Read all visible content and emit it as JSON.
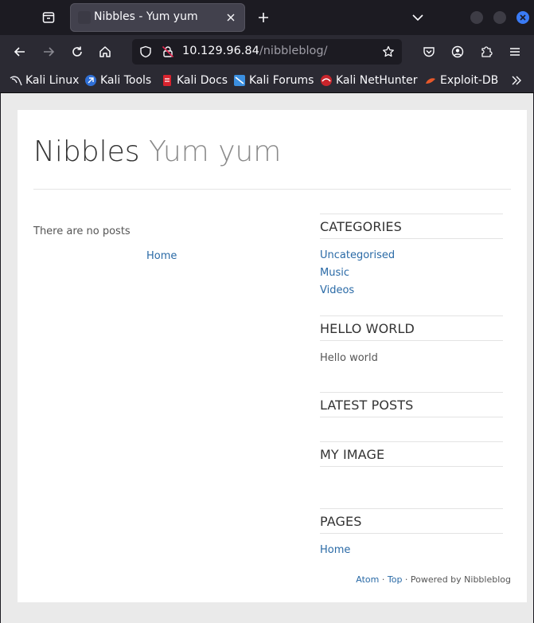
{
  "browser": {
    "tab_title": "Nibbles - Yum yum",
    "url_host": "10.129.96.84",
    "url_path": "/nibbleblog/",
    "bookmarks": [
      {
        "label": "Kali Linux",
        "icon": "kali-dragon-icon"
      },
      {
        "label": "Kali Tools",
        "icon": "kali-tools-icon"
      },
      {
        "label": "Kali Docs",
        "icon": "kali-docs-icon"
      },
      {
        "label": "Kali Forums",
        "icon": "kali-forums-icon"
      },
      {
        "label": "Kali NetHunter",
        "icon": "kali-nethunter-icon"
      },
      {
        "label": "Exploit-DB",
        "icon": "exploit-db-icon"
      }
    ],
    "colors": {
      "tabbar": "#1c1b22",
      "toolbar": "#2b2a33",
      "accent": "#3a7bf5"
    }
  },
  "blog": {
    "name": "Nibbles",
    "slogan": "Yum yum",
    "no_posts": "There are no posts",
    "home_link": "Home"
  },
  "sidebar": {
    "categories": {
      "title": "CATEGORIES",
      "items": [
        "Uncategorised",
        "Music",
        "Videos"
      ]
    },
    "hello": {
      "title": "HELLO WORLD",
      "text": "Hello world"
    },
    "latest": {
      "title": "LATEST POSTS"
    },
    "image": {
      "title": "MY IMAGE"
    },
    "pages": {
      "title": "PAGES",
      "items": [
        "Home"
      ]
    }
  },
  "footer": {
    "atom": "Atom",
    "sep1": " · ",
    "top": "Top",
    "powered": " · Powered by Nibbleblog"
  },
  "colors": {
    "link": "#2a6aa6",
    "text": "#333333"
  }
}
